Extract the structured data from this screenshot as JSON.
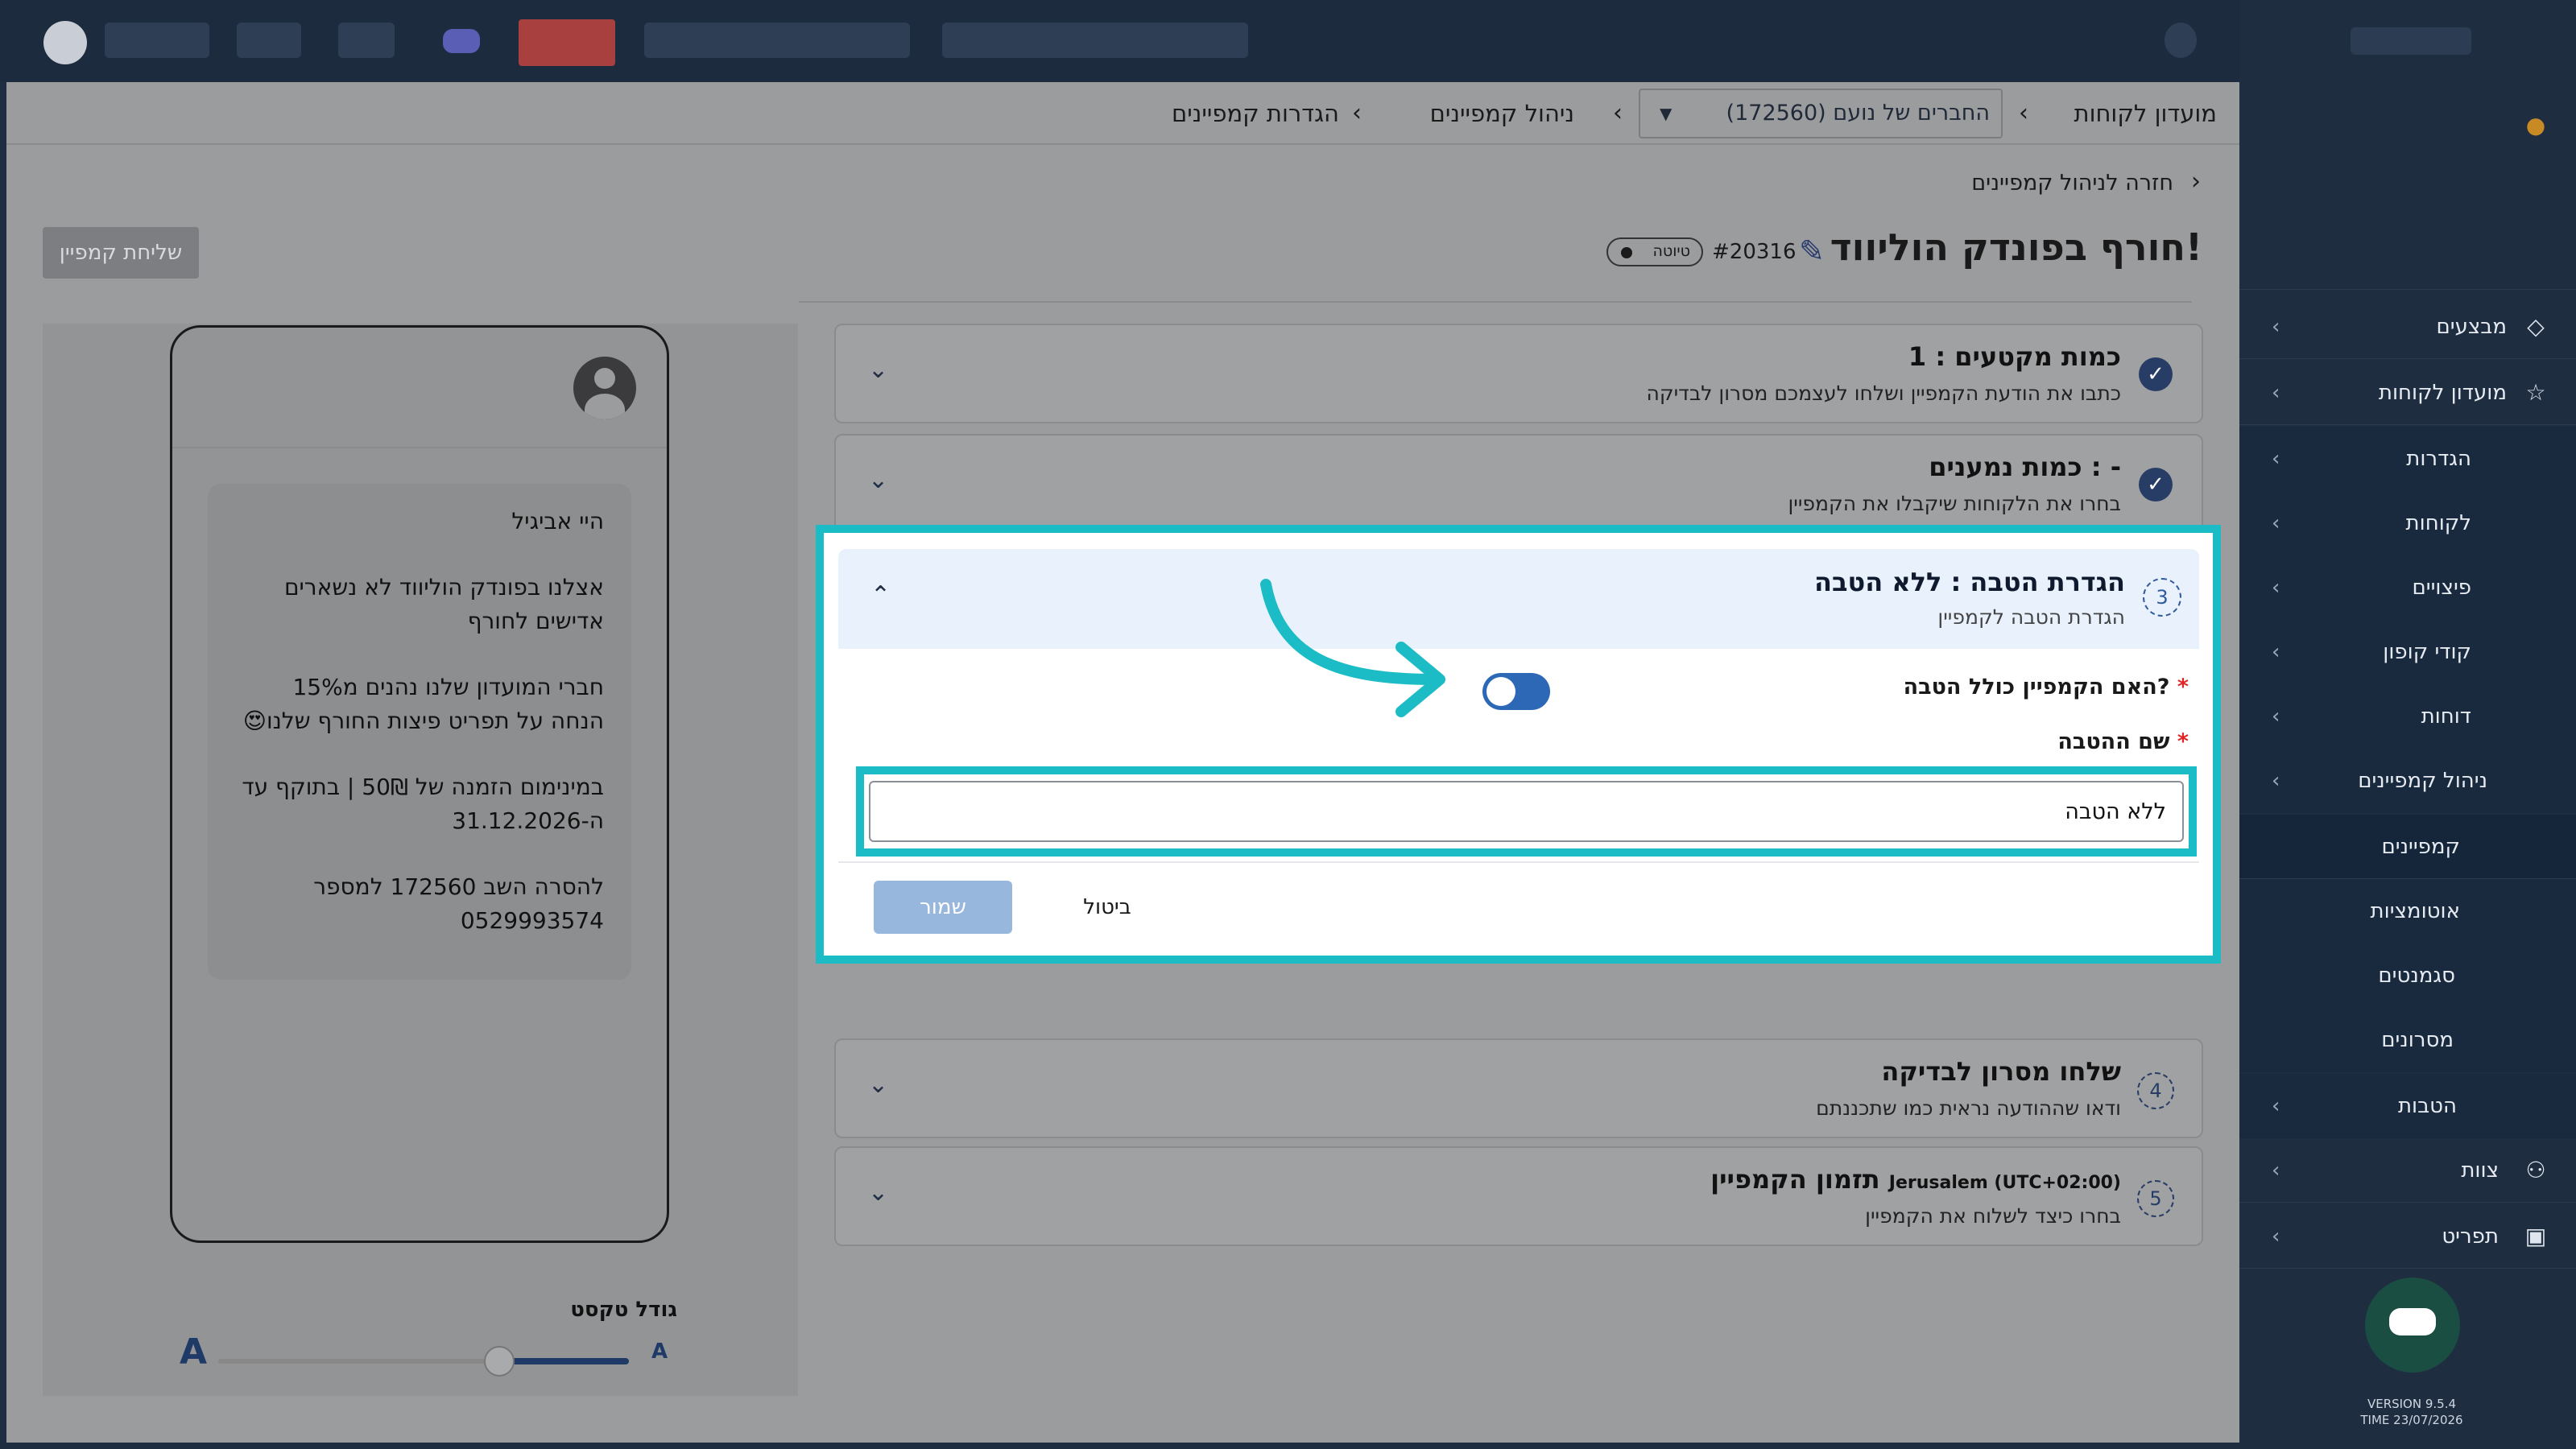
{
  "colors": {
    "accent": "#1bbcc5",
    "primary": "#2d68b6",
    "sidebar_bg": "#1e2d40"
  },
  "breadcrumb": {
    "root": "מועדון לקוחות",
    "club_select": "החברים של נועם (172560)",
    "manage": "ניהול קמפיינים",
    "settings": "הגדרות קמפיינים"
  },
  "campaign": {
    "back_link": "חזרה לניהול קמפיינים",
    "title": "חורף בפונדק הוליווד!",
    "id": "#20316",
    "status": "טיוטה",
    "send_button": "שליחת קמפיין"
  },
  "steps": [
    {
      "title": "כמות מקטעים : 1",
      "desc": "כתבו את הודעת הקמפיין ושלחו לעצמכם מסרון לבדיקה"
    },
    {
      "title": "כמות נמענים : -",
      "desc": "בחרו את הלקוחות שיקבלו את הקמפיין"
    },
    {
      "num": "3",
      "title": "הגדרת הטבה : ללא הטבה",
      "desc": "הגדרת הטבה לקמפיין",
      "question": "האם הקמפיין כולל הטבה?",
      "name_label": "שם ההטבה",
      "name_value": "ללא הטבה",
      "save": "שמור",
      "cancel": "ביטול"
    },
    {
      "num": "4",
      "title": "שלחו מסרון לבדיקה",
      "desc": "ודאו שההודעה נראית כמו שתכננתם"
    },
    {
      "num": "5",
      "title": "תזמון הקמפיין",
      "tz": "Jerusalem (UTC+02:00)",
      "desc": "בחרו כיצד לשלוח את הקמפיין"
    }
  ],
  "preview": {
    "messages": [
      "היי אביגיל",
      "אצלנו בפונדק הוליווד לא נשארים אדישים לחורף",
      "חברי המועדון שלנו נהנים מ15% הנחה על תפריט פיצות החורף שלנו😍",
      "במינימום הזמנה של 50₪ | בתוקף עד ה-31.12.2026",
      "להסרה השב 172560 למספר 0529993574"
    ],
    "text_size_label": "גודל טקסט",
    "big_a": "A",
    "small_a": "A"
  },
  "sidebar": {
    "items": [
      {
        "label": "מבצעים",
        "icon": "tag-icon"
      },
      {
        "label": "מועדון לקוחות",
        "icon": "star-icon"
      },
      {
        "label": "הגדרות"
      },
      {
        "label": "לקוחות"
      },
      {
        "label": "פיצויים"
      },
      {
        "label": "קודי קופון"
      },
      {
        "label": "דוחות"
      },
      {
        "label": "ניהול קמפיינים"
      },
      {
        "label": "קמפיינים"
      },
      {
        "label": "אוטומציות"
      },
      {
        "label": "סגמנטים"
      },
      {
        "label": "מסרונים"
      },
      {
        "label": "הטבות"
      },
      {
        "label": "צוות",
        "icon": "team-icon"
      },
      {
        "label": "תפריט",
        "icon": "menu-icon"
      }
    ],
    "version": "VERSION 9.5.4",
    "time": "TIME 23/07/2026"
  }
}
